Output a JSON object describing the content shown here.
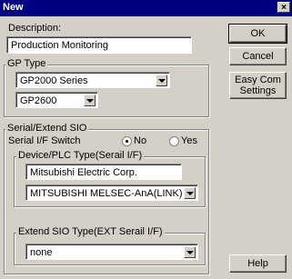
{
  "window": {
    "title": "New",
    "close_label": "×"
  },
  "description": {
    "label": "Description:",
    "value": "Production Monitoring"
  },
  "gp_type": {
    "legend": "GP Type",
    "series": "GP2000 Series",
    "model": "GP2600"
  },
  "serial": {
    "legend": "Serial/Extend SIO",
    "switch_label": "Serial I/F Switch",
    "option_no": "No",
    "option_yes": "Yes",
    "selected": "No"
  },
  "device": {
    "legend": "Device/PLC Type(Serail I/F)",
    "maker": "Mitsubishi Electric Corp.",
    "model": "MITSUBISHI MELSEC-AnA(LINK)"
  },
  "extend": {
    "legend": "Extend SIO Type(EXT Serail I/F)",
    "value": "none"
  },
  "buttons": {
    "ok": "OK",
    "cancel": "Cancel",
    "easy_com": "Easy Com Settings",
    "help": "Help"
  }
}
